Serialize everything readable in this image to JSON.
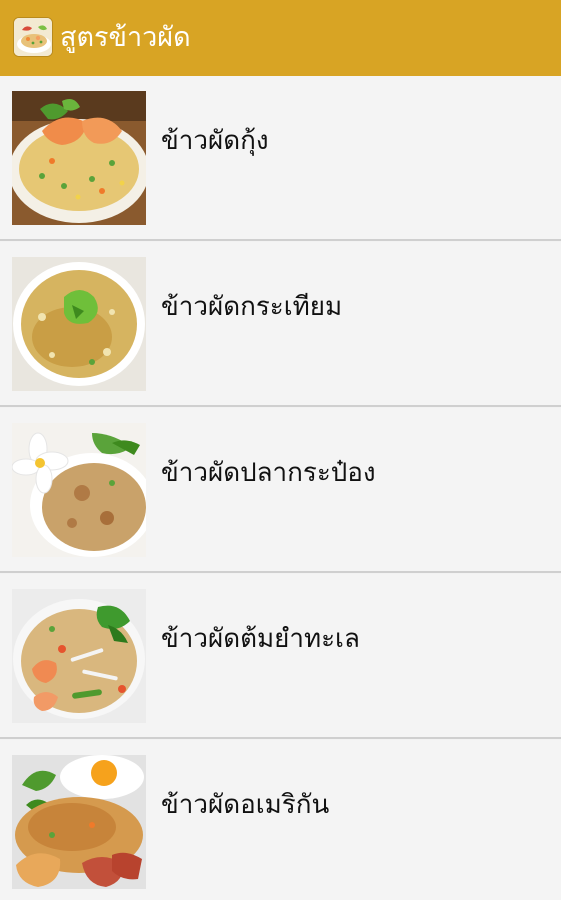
{
  "app": {
    "title": "สูตรข้าวผัด",
    "accent_color": "#d8a424",
    "icon": "fried-rice-app-icon"
  },
  "recipes": [
    {
      "label": "ข้าวผัดกุ้ง",
      "thumb_icon": "shrimp-fried-rice-photo"
    },
    {
      "label": "ข้าวผัดกระเทียม",
      "thumb_icon": "garlic-fried-rice-photo"
    },
    {
      "label": "ข้าวผัดปลากระป๋อง",
      "thumb_icon": "canned-fish-fried-rice-photo"
    },
    {
      "label": "ข้าวผัดต้มยำทะเล",
      "thumb_icon": "tom-yum-seafood-fried-rice-photo"
    },
    {
      "label": "ข้าวผัดอเมริกัน",
      "thumb_icon": "american-fried-rice-photo"
    }
  ]
}
